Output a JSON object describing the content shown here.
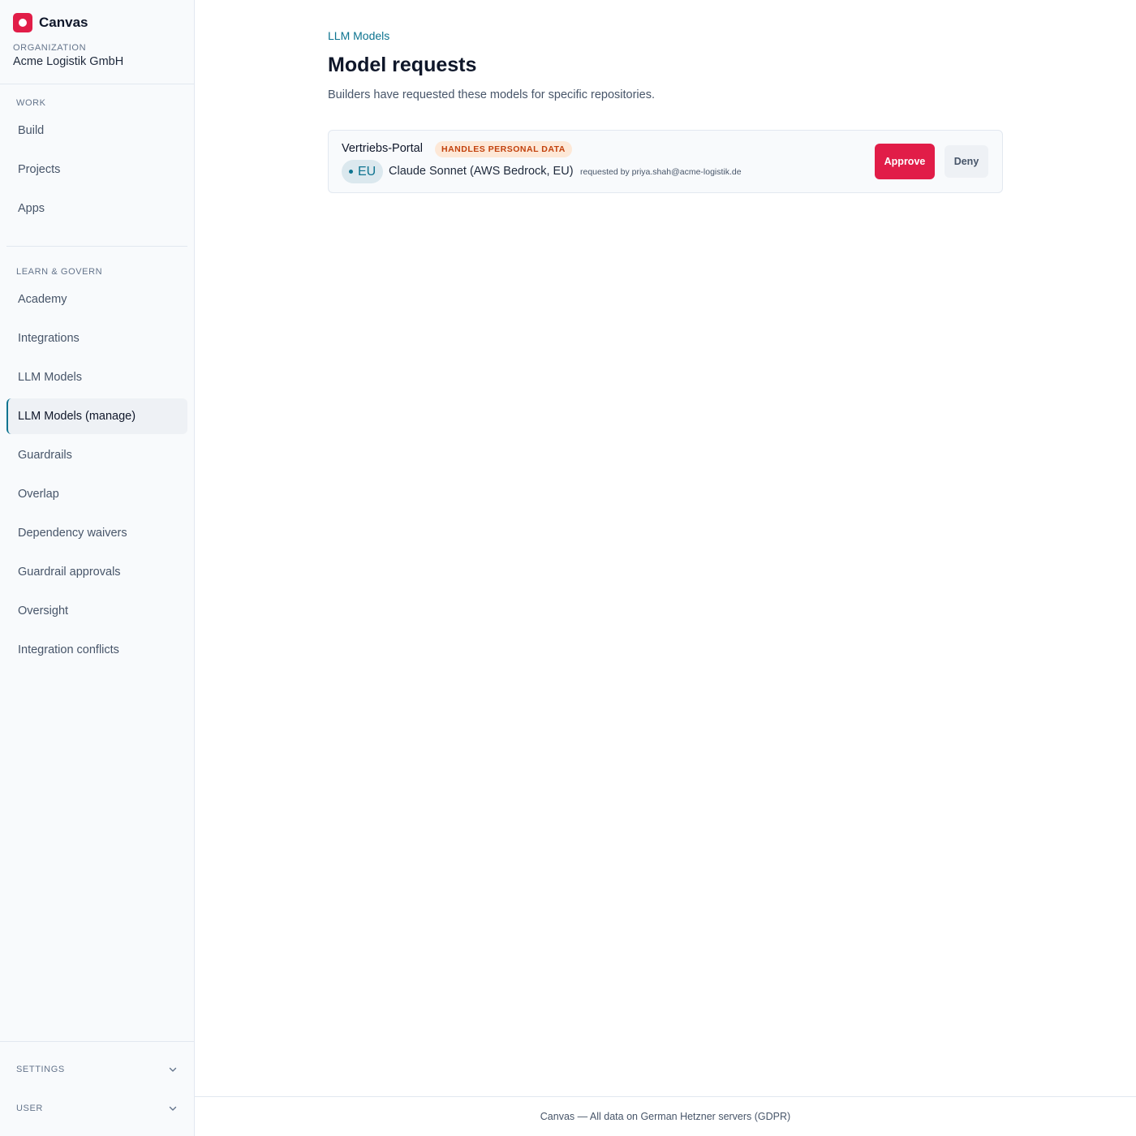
{
  "brand": {
    "name": "Canvas",
    "accent_color": "#e11d48"
  },
  "organization": {
    "label": "ORGANIZATION",
    "name": "Acme Logistik GmbH"
  },
  "sidebar": {
    "sections": [
      {
        "label": "WORK",
        "items": [
          "Build",
          "Projects",
          "Apps"
        ]
      },
      {
        "label": "LEARN & GOVERN",
        "items": [
          "Academy",
          "Integrations",
          "LLM Models",
          "LLM Models (manage)",
          "Guardrails",
          "Overlap",
          "Dependency waivers",
          "Guardrail approvals",
          "Oversight",
          "Integration conflicts"
        ]
      }
    ],
    "active_item": "LLM Models (manage)",
    "collapsibles": [
      {
        "label": "SETTINGS",
        "icon": "chevron-down-icon"
      },
      {
        "label": "USER",
        "icon": "chevron-down-icon"
      }
    ]
  },
  "main": {
    "breadcrumb": "LLM Models",
    "title": "Model requests",
    "description": "Builders have requested these models for specific repositories.",
    "requests": [
      {
        "repository": "Vertriebs-Portal",
        "badge": "HANDLES PERSONAL DATA",
        "region": "EU",
        "model": "Claude Sonnet (AWS Bedrock, EU)",
        "requested_by": "requested by priya.shah@acme-logistik.de",
        "approve_label": "Approve",
        "deny_label": "Deny"
      }
    ]
  },
  "footer": {
    "text": "Canvas — All data on German Hetzner servers (GDPR)"
  }
}
